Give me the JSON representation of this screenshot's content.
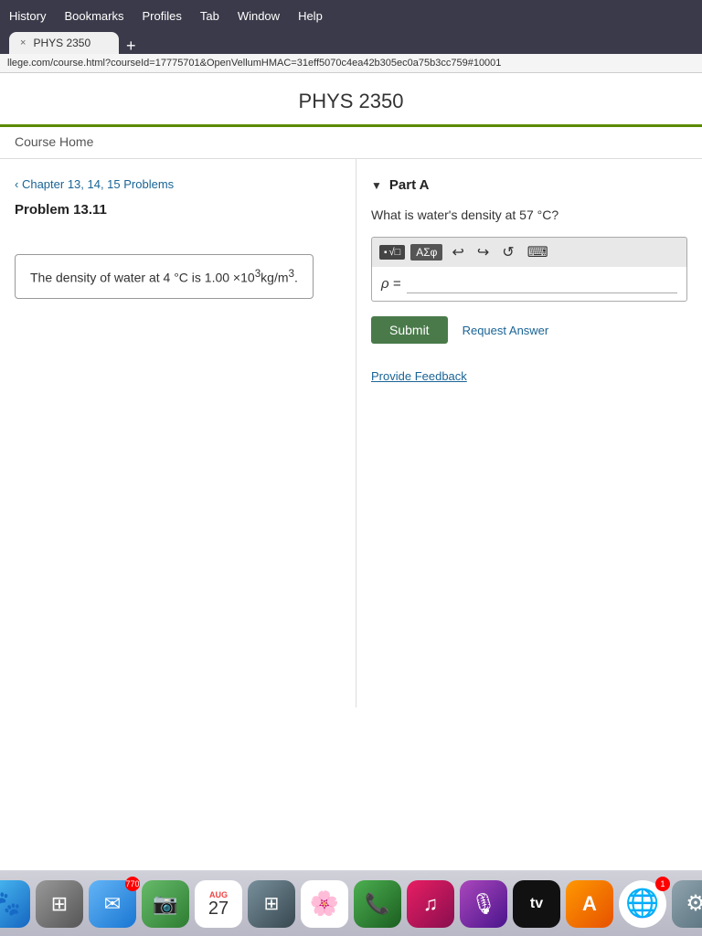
{
  "browser": {
    "menu_items": [
      "History",
      "Bookmarks",
      "Profiles",
      "Tab",
      "Window",
      "Help"
    ],
    "tab_label": "×",
    "tab_add": "+",
    "url": "llege.com/course.html?courseId=17775701&OpenVellumHMAC=31eff5070c4ea42b305ec0a75b3cc759#10001"
  },
  "page": {
    "title": "PHYS 2350",
    "nav_label": "Course Home",
    "breadcrumb": "Chapter 13, 14, 15 Problems",
    "problem_label": "Problem 13.11",
    "problem_text": "The density of water at 4 °C is 1.00 ×10",
    "problem_sup1": "3",
    "problem_text2": "kg/m",
    "problem_sup2": "3",
    "problem_text3": "."
  },
  "part_a": {
    "toggle": "▼",
    "label": "Part A",
    "question": "What is water's density at 57 °C?",
    "rho_label": "ρ =",
    "toolbar": {
      "matrix_icon": "▪√□",
      "greek_btn": "ΑΣφ",
      "undo": "↩",
      "redo": "↪",
      "refresh": "↺",
      "keyboard": "⌨"
    },
    "submit_label": "Submit",
    "request_answer_label": "Request Answer",
    "feedback_label": "Provide Feedback"
  },
  "dock": {
    "items": [
      {
        "name": "finder",
        "icon": "🔵",
        "badge": null
      },
      {
        "name": "launchpad",
        "icon": "🔲",
        "badge": null
      },
      {
        "name": "mail",
        "icon": "✉️",
        "badge": "770"
      },
      {
        "name": "facetime",
        "icon": "📹",
        "badge": null
      },
      {
        "name": "calendar",
        "icon": "date",
        "month": "AUG",
        "day": "27"
      },
      {
        "name": "apps",
        "icon": "⬛",
        "badge": null
      },
      {
        "name": "photos",
        "icon": "🌸",
        "badge": null
      },
      {
        "name": "facetime2",
        "icon": "🟢",
        "badge": null
      },
      {
        "name": "music",
        "icon": "🎵",
        "badge": null
      },
      {
        "name": "podcast",
        "icon": "🎙️",
        "badge": null
      },
      {
        "name": "appletv",
        "icon": "📺",
        "badge": null
      },
      {
        "name": "swift",
        "icon": "🅰",
        "badge": null
      },
      {
        "name": "chrome",
        "icon": "🔵",
        "badge": "1"
      },
      {
        "name": "settings",
        "icon": "⚙️",
        "badge": null
      }
    ]
  }
}
